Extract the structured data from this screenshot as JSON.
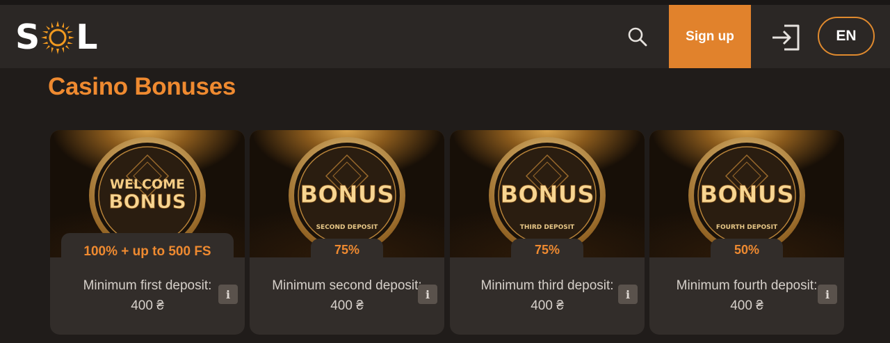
{
  "header": {
    "logo": "SOL",
    "signup_label": "Sign up",
    "language": "EN",
    "icons": [
      "search-icon",
      "login-icon"
    ]
  },
  "page": {
    "title": "Casino Bonuses"
  },
  "cards": [
    {
      "badge": "WELCOME BONUS",
      "badge_line1": "WELCOME",
      "badge_line2": "BONUS",
      "ring_text": "",
      "amount": "100% + up to 500 FS",
      "description": "Minimum first deposit: 400 ₴",
      "info": "i"
    },
    {
      "badge": "BONUS",
      "badge_line1": "",
      "badge_line2": "BONUS",
      "ring_text": "SECOND DEPOSIT",
      "amount": "75%",
      "description": "Minimum second deposit: 400 ₴",
      "info": "i"
    },
    {
      "badge": "BONUS",
      "badge_line1": "",
      "badge_line2": "BONUS",
      "ring_text": "THIRD DEPOSIT",
      "amount": "75%",
      "description": "Minimum third deposit: 400 ₴",
      "info": "i"
    },
    {
      "badge": "BONUS",
      "badge_line1": "",
      "badge_line2": "BONUS",
      "ring_text": "FOURTH DEPOSIT",
      "amount": "50%",
      "description": "Minimum fourth deposit: 400 ₴",
      "info": "i"
    }
  ],
  "colors": {
    "accent": "#e1822c",
    "title": "#ef8a30",
    "background": "#201c1a",
    "header": "#2b2725",
    "card": "#322d2a"
  }
}
